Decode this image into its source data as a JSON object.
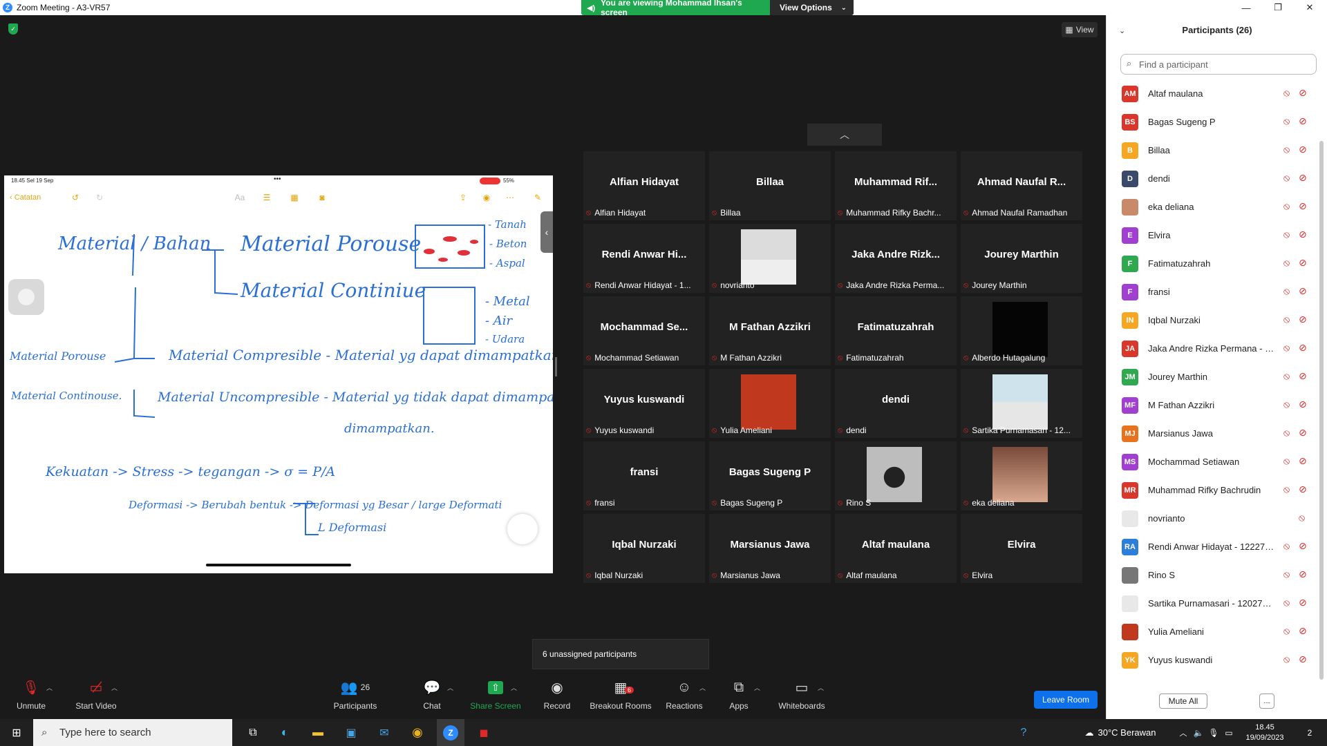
{
  "window": {
    "title": "Zoom Meeting - A3-VR57"
  },
  "banner": {
    "viewing": "You are viewing Mohammad Ihsan's screen",
    "view_options": "View Options"
  },
  "meeting": {
    "view_label": "View"
  },
  "share": {
    "status_time": "18.45  Sel 19 Sep",
    "status_battery": "55%",
    "notes_back": "Catatan",
    "notes_format": "Aa",
    "handwriting": {
      "title": "Material / Bahan",
      "porous": "Material Porouse",
      "continue": "Material Continiue",
      "tanah": "- Tanah",
      "beton": "- Beton",
      "aspal": "- Aspal",
      "metal": "- Metal",
      "air": "- Air",
      "udara": "- Udara",
      "left1": "Material Porouse",
      "left2": "Material Continouse.",
      "compressible": "Material Compresible - Material yg dapat dimampatkan",
      "uncompressible": "Material Uncompresible - Material yg tidak dapat dimampa",
      "dimampatkan": "dimampatkan.",
      "kekuatan": "Kekuatan -> Stress -> tegangan -> σ = P/A",
      "deformasi": "Deformasi -> Berubah bentuk -> Deformasi yg Besar / large Deformati",
      "deformasi2": "L Deformasi"
    }
  },
  "gallery": {
    "tiles": [
      {
        "name": "Alfian Hidayat",
        "label": "Alfian Hidayat",
        "video": "none"
      },
      {
        "name": "Billaa",
        "label": "Billaa",
        "video": "none"
      },
      {
        "name": "Muhammad  Rif...",
        "label": "Muhammad Rifky Bachr...",
        "video": "none"
      },
      {
        "name": "Ahmad Naufal R...",
        "label": "Ahmad Naufal Ramadhan",
        "video": "none"
      },
      {
        "name": "Rendi Anwar Hi...",
        "label": "Rendi Anwar Hidayat - 1...",
        "video": "none"
      },
      {
        "name": "",
        "label": "novrianto",
        "video": "photo-man"
      },
      {
        "name": "Jaka Andre Rizk...",
        "label": "Jaka Andre Rizka Perma...",
        "video": "none"
      },
      {
        "name": "Jourey Marthin",
        "label": "Jourey Marthin",
        "video": "none"
      },
      {
        "name": "Mochammad  Se...",
        "label": "Mochammad Setiawan",
        "video": "none"
      },
      {
        "name": "M Fathan Azzikri",
        "label": "M Fathan Azzikri",
        "video": "none"
      },
      {
        "name": "Fatimatuzahrah",
        "label": "Fatimatuzahrah",
        "video": "none"
      },
      {
        "name": "",
        "label": "Alberdo Hutagalung",
        "video": "black"
      },
      {
        "name": "Yuyus kuswandi",
        "label": "Yuyus kuswandi",
        "video": "none"
      },
      {
        "name": "",
        "label": "Yulia Ameliani",
        "video": "orange"
      },
      {
        "name": "dendi",
        "label": "dendi",
        "video": "none"
      },
      {
        "name": "",
        "label": "Sartika Purnamasari - 12...",
        "video": "photo-woman"
      },
      {
        "name": "fransi",
        "label": "fransi",
        "video": "none"
      },
      {
        "name": "Bagas Sugeng P",
        "label": "Bagas Sugeng P",
        "video": "none"
      },
      {
        "name": "",
        "label": "Rino S",
        "video": "photo-gray"
      },
      {
        "name": "",
        "label": "eka deliana",
        "video": "photo-girl"
      },
      {
        "name": "Iqbal Nurzaki",
        "label": "Iqbal Nurzaki",
        "video": "none"
      },
      {
        "name": "Marsianus Jawa",
        "label": "Marsianus Jawa",
        "video": "none"
      },
      {
        "name": "Altaf maulana",
        "label": "Altaf maulana",
        "video": "none"
      },
      {
        "name": "Elvira",
        "label": "Elvira",
        "video": "none"
      }
    ],
    "unassigned": "6 unassigned participants"
  },
  "toolbar": {
    "unmute": "Unmute",
    "start_video": "Start Video",
    "participants": "Participants",
    "participants_count": "26",
    "chat": "Chat",
    "share_screen": "Share Screen",
    "record": "Record",
    "breakout": "Breakout Rooms",
    "breakout_badge": "6",
    "reactions": "Reactions",
    "apps": "Apps",
    "whiteboards": "Whiteboards",
    "leave": "Leave Room"
  },
  "panel": {
    "title": "Participants (26)",
    "search_placeholder": "Find a participant",
    "mute_all": "Mute All",
    "more": "...",
    "participants": [
      {
        "initials": "AM",
        "name": "Altaf maulana",
        "color": "#d9372b",
        "cam": true
      },
      {
        "initials": "BS",
        "name": "Bagas Sugeng P",
        "color": "#d9372b",
        "cam": true
      },
      {
        "initials": "B",
        "name": "Billaa",
        "color": "#f5a623",
        "cam": true
      },
      {
        "initials": "D",
        "name": "dendi",
        "color": "#3b4a6b",
        "cam": true
      },
      {
        "initials": "",
        "name": "eka deliana",
        "color": "#c98a6a",
        "cam": true
      },
      {
        "initials": "E",
        "name": "Elvira",
        "color": "#a13fd1",
        "cam": true
      },
      {
        "initials": "F",
        "name": "Fatimatuzahrah",
        "color": "#2fa84f",
        "cam": true
      },
      {
        "initials": "F",
        "name": "fransi",
        "color": "#a13fd1",
        "cam": true
      },
      {
        "initials": "IN",
        "name": "Iqbal Nurzaki",
        "color": "#f5a623",
        "cam": true
      },
      {
        "initials": "JA",
        "name": "Jaka Andre Rizka Permana - 12...",
        "color": "#d9372b",
        "cam": true
      },
      {
        "initials": "JM",
        "name": "Jourey Marthin",
        "color": "#2fa84f",
        "cam": true
      },
      {
        "initials": "MF",
        "name": "M Fathan Azzikri",
        "color": "#a13fd1",
        "cam": true
      },
      {
        "initials": "MJ",
        "name": "Marsianus Jawa",
        "color": "#e8731f",
        "cam": true
      },
      {
        "initials": "MS",
        "name": "Mochammad Setiawan",
        "color": "#a13fd1",
        "cam": true
      },
      {
        "initials": "MR",
        "name": "Muhammad Rifky Bachrudin",
        "color": "#d9372b",
        "cam": true
      },
      {
        "initials": "",
        "name": "novrianto",
        "color": "#e8e8e8",
        "cam": false
      },
      {
        "initials": "RA",
        "name": "Rendi Anwar Hidayat - 122272...",
        "color": "#2b7fd9",
        "cam": true
      },
      {
        "initials": "",
        "name": "Rino S",
        "color": "#777777",
        "cam": true
      },
      {
        "initials": "",
        "name": "Sartika Purnamasari - 1202724...",
        "color": "#e8e8e8",
        "cam": true
      },
      {
        "initials": "",
        "name": "Yulia Ameliani",
        "color": "#c0391f",
        "cam": true
      },
      {
        "initials": "YK",
        "name": "Yuyus kuswandi",
        "color": "#f5a623",
        "cam": true
      }
    ]
  },
  "taskbar": {
    "search_placeholder": "Type here to search",
    "weather": "30°C  Berawan",
    "time": "18.45",
    "date": "19/09/2023",
    "notif": "2"
  },
  "colors": {
    "zoom_blue": "#0e71eb",
    "green": "#1fa84f",
    "muted_red": "#e02828"
  }
}
